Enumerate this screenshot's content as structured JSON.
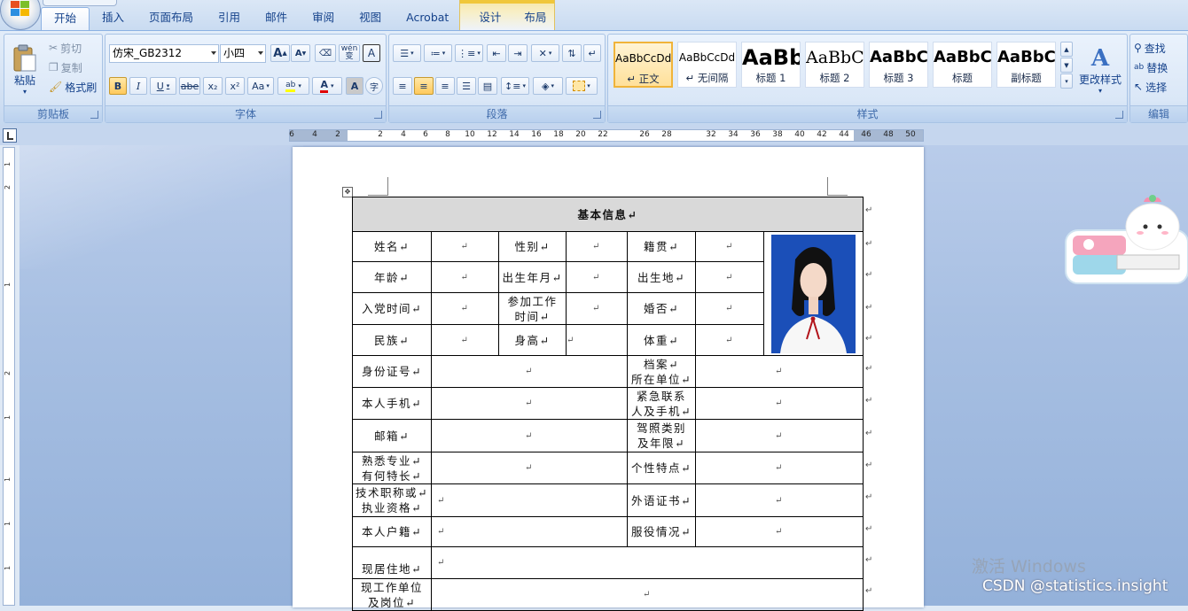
{
  "ribbon": {
    "tabs": [
      "开始",
      "插入",
      "页面布局",
      "引用",
      "邮件",
      "审阅",
      "视图",
      "Acrobat",
      "设计",
      "布局"
    ],
    "active_tab": "开始",
    "clipboard": {
      "paste": "粘贴",
      "cut": "剪切",
      "copy": "复制",
      "format_painter": "格式刷",
      "label": "剪贴板"
    },
    "font": {
      "name": "仿宋_GB2312",
      "size": "小四",
      "label": "字体",
      "bold": "B",
      "italic": "I",
      "underline": "U",
      "strike": "abe",
      "sub": "x₂",
      "sup": "x²",
      "case": "Aa",
      "grow": "A",
      "shrink": "A",
      "phonetic": "wén",
      "border_char": "A",
      "shade_char": "A",
      "enclose": "字"
    },
    "paragraph": {
      "label": "段落"
    },
    "styles": {
      "label": "样式",
      "change_styles": "更改样式",
      "items": [
        {
          "sample": "AaBbCcDd",
          "name": "↵ 正文"
        },
        {
          "sample": "AaBbCcDd",
          "name": "↵ 无间隔"
        },
        {
          "sample": "AaBb",
          "name": "标题 1"
        },
        {
          "sample": "AaBbC",
          "name": "标题 2"
        },
        {
          "sample": "AaBbC",
          "name": "标题 3"
        },
        {
          "sample": "AaBbC",
          "name": "标题"
        },
        {
          "sample": "AaBbC",
          "name": "副标题"
        }
      ]
    },
    "editing": {
      "find": "查找",
      "replace": "替换",
      "select": "选择",
      "label": "编辑"
    }
  },
  "ruler": {
    "numbers": [
      "6",
      "4",
      "2",
      "2",
      "4",
      "6",
      "8",
      "10",
      "12",
      "14",
      "16",
      "18",
      "20",
      "22",
      "26",
      "28",
      "32",
      "34",
      "36",
      "38",
      "40",
      "42",
      "44",
      "46",
      "48",
      "50"
    ]
  },
  "vruler": {
    "numbers": [
      "1",
      "2",
      "1",
      "2",
      "1",
      "1",
      "1",
      "1",
      "2",
      "2",
      "2"
    ]
  },
  "form": {
    "title": "基本信息↵",
    "mark": "↵",
    "labels": {
      "name": "姓名↵",
      "gender": "性别↵",
      "native": "籍贯↵",
      "age": "年龄↵",
      "birth_month": "出生年月↵",
      "birthplace": "出生地↵",
      "party_time": "入党时间↵",
      "work_time_1": "参加工作",
      "work_time_2": "时间↵",
      "marital": "婚否↵",
      "ethnic": "民族↵",
      "height": "身高↵",
      "weight": "体重↵",
      "id_no": "身份证号↵",
      "archive_1": "档案↵",
      "archive_2": "所在单位↵",
      "phone": "本人手机↵",
      "emergency_1": "紧急联系",
      "emergency_2": "人及手机↵",
      "email": "邮箱↵",
      "license_1": "驾照类别",
      "license_2": "及年限↵",
      "skill_1": "熟悉专业↵",
      "skill_2": "有何特长↵",
      "personality": "个性特点↵",
      "title_1": "技术职称或↵",
      "title_2": "执业资格↵",
      "lang_cert": "外语证书↵",
      "hukou": "本人户籍↵",
      "service": "服役情况↵",
      "address": "现居住地↵",
      "work_unit_1": "现工作单位",
      "work_unit_2": "及岗位↵"
    }
  },
  "overlay": {
    "watermark": "激活 Windows",
    "csdn": "CSDN @statistics.insight"
  }
}
